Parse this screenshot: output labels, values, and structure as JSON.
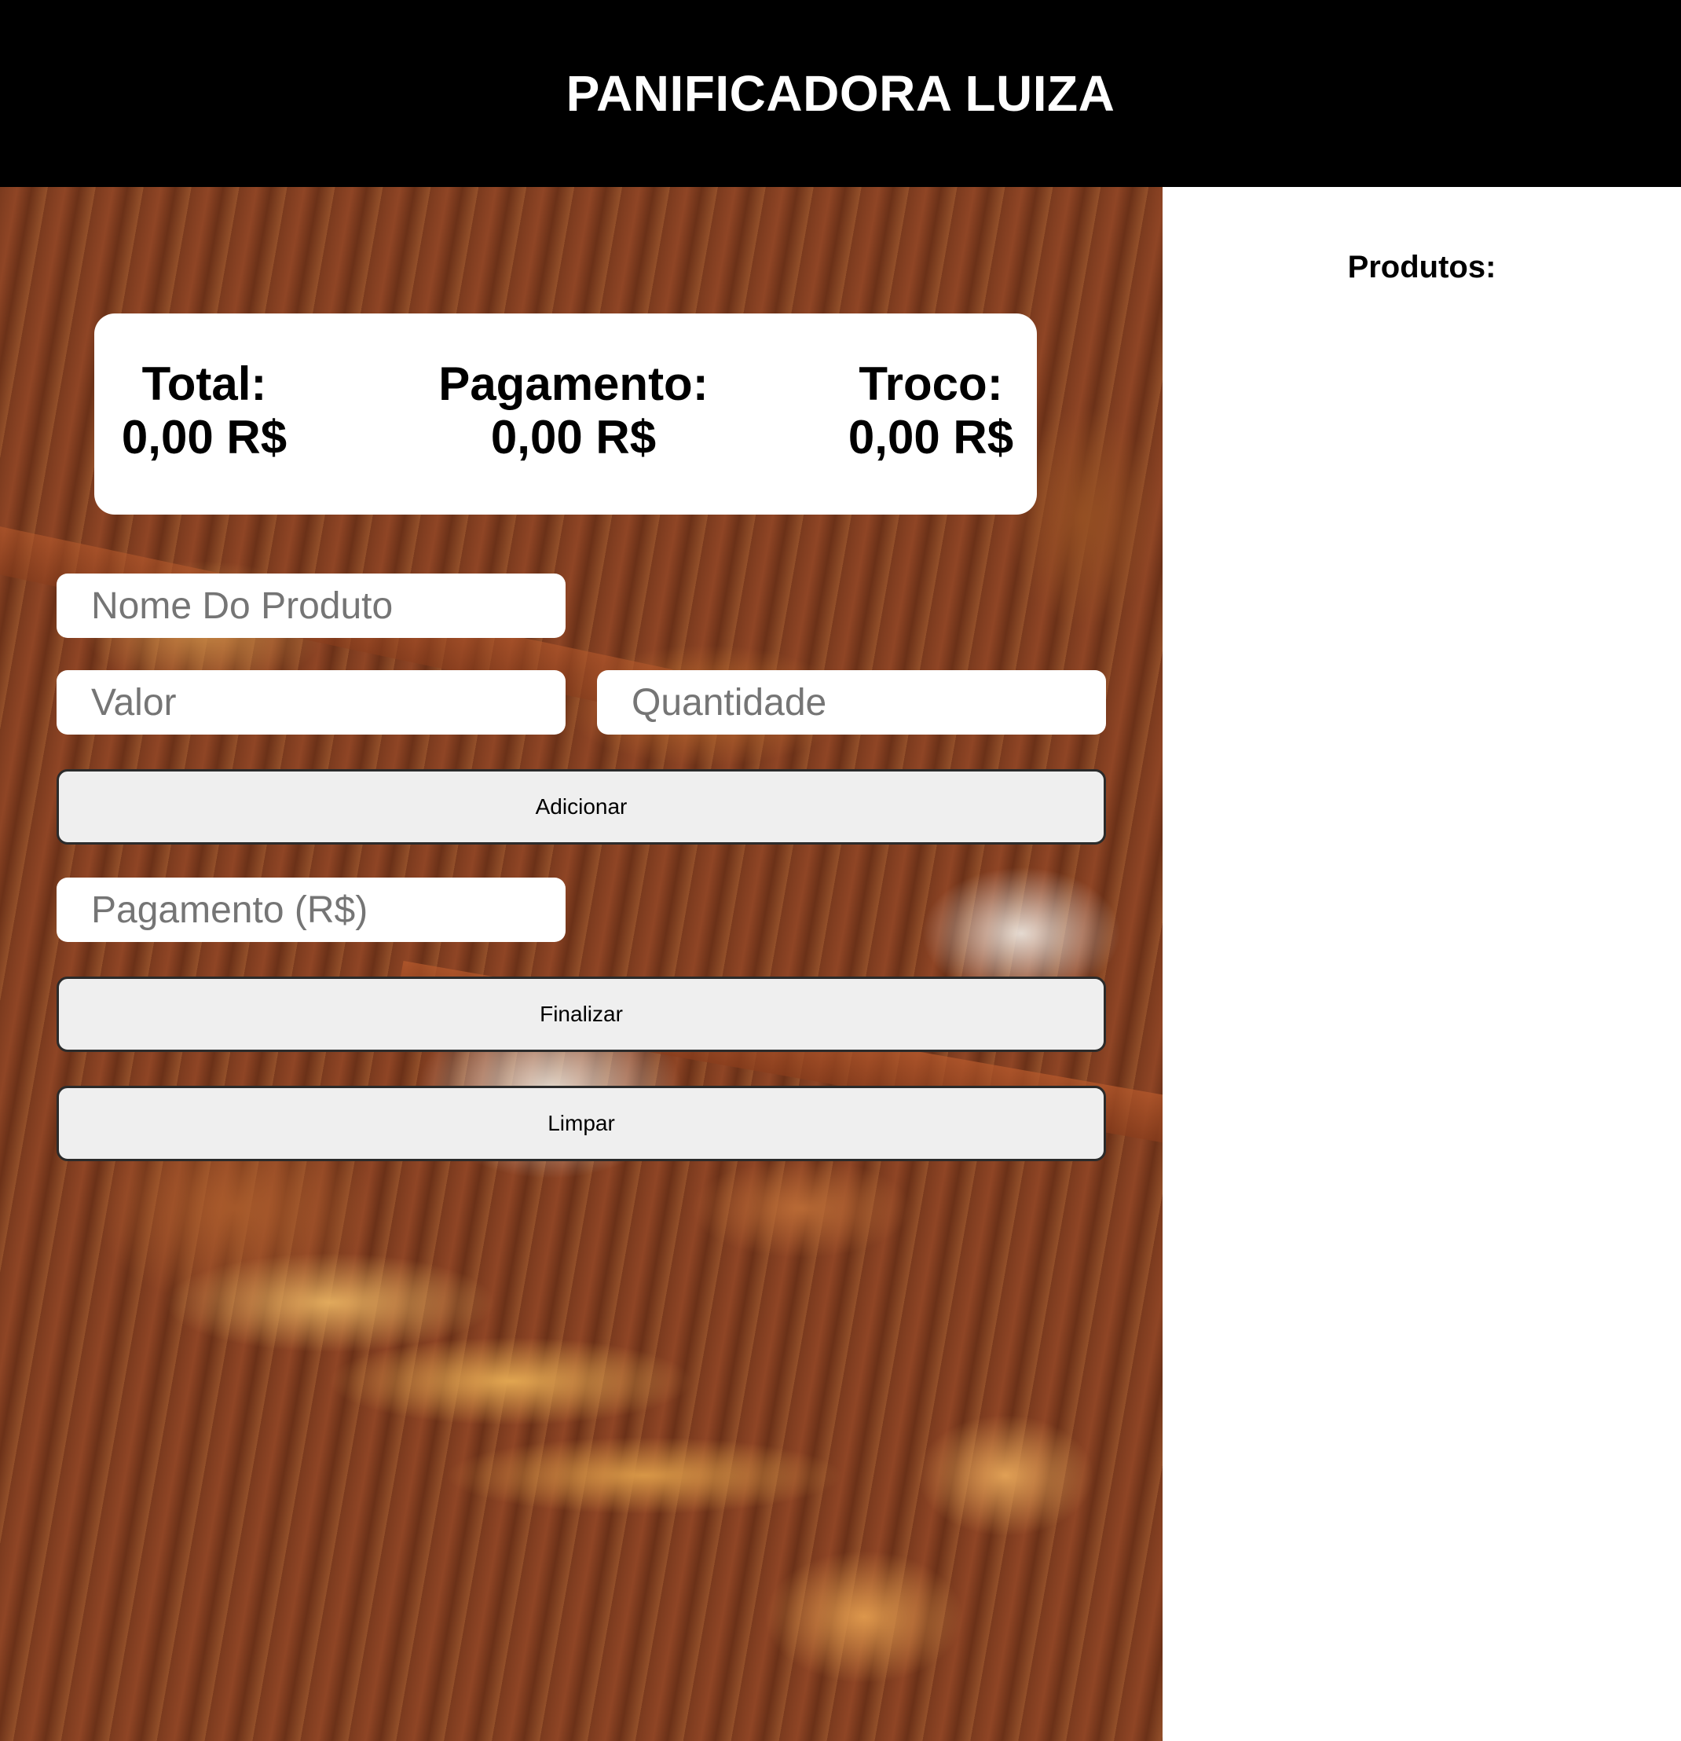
{
  "header": {
    "title": "PANIFICADORA LUIZA"
  },
  "summary": {
    "total_label": "Total:",
    "total_value": "0,00 R$",
    "payment_label": "Pagamento:",
    "payment_value": "0,00 R$",
    "change_label": "Troco:",
    "change_value": "0,00 R$"
  },
  "form": {
    "product_name_placeholder": "Nome Do Produto",
    "value_placeholder": "Valor",
    "quantity_placeholder": "Quantidade",
    "payment_placeholder": "Pagamento (R$)",
    "add_button": "Adicionar",
    "finish_button": "Finalizar",
    "clear_button": "Limpar"
  },
  "products_panel": {
    "title": "Produtos:",
    "items": []
  },
  "background": {
    "image": "bread-display-photo"
  },
  "colors": {
    "header_bg": "#000000",
    "header_text": "#ffffff",
    "button_bg": "#efefef",
    "button_border": "#2b2b2b"
  }
}
